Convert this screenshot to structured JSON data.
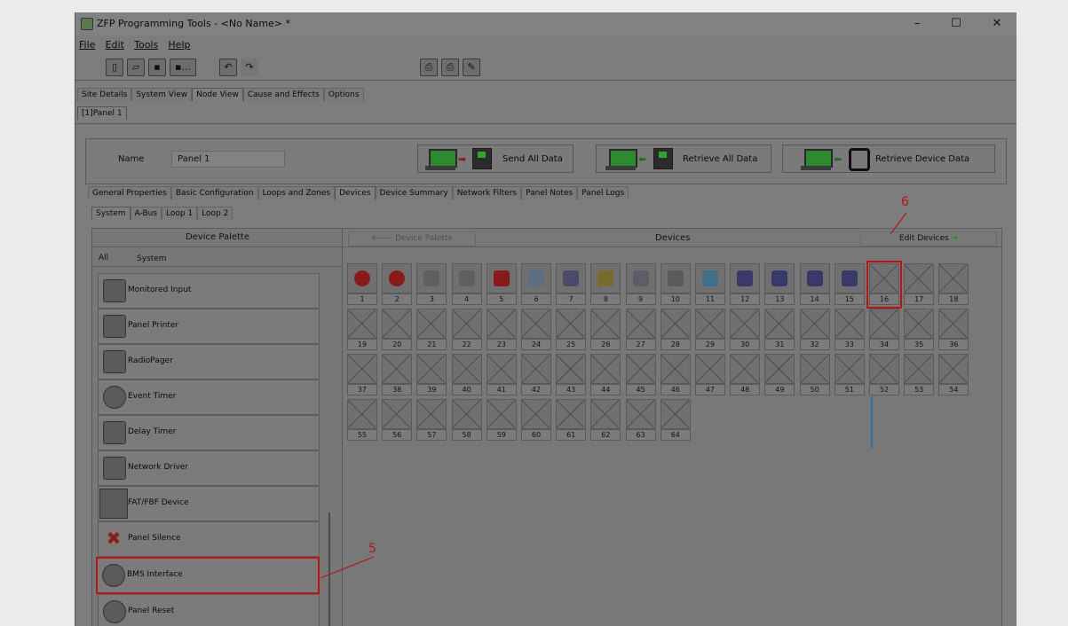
{
  "window": {
    "title": "ZFP Programming Tools - <No Name> *",
    "controls": [
      "–",
      "☐",
      "✕"
    ]
  },
  "menu": [
    "File",
    "Edit",
    "Tools",
    "Help"
  ],
  "toolbar": {
    "icons": [
      "new-icon",
      "open-icon",
      "save-icon",
      "save-as-icon",
      "undo-icon",
      "redo-icon",
      "print-icon",
      "print-preview-icon",
      "print-setup-icon"
    ],
    "save_as_suffix": "..."
  },
  "main_tabs": [
    "Site Details",
    "System View",
    "Node View",
    "Cause and Effects",
    "Options"
  ],
  "node_tab": "[1]Panel 1",
  "name_label": "Name",
  "name_value": "Panel 1",
  "buttons": {
    "send": "Send All Data",
    "retrieve": "Retrieve All Data",
    "retrieve_device": "Retrieve Device Data"
  },
  "sub_tabs": [
    "General Properties",
    "Basic Configuration",
    "Loops and Zones",
    "Devices",
    "Device Summary",
    "Network Filters",
    "Panel Notes",
    "Panel Logs"
  ],
  "bus_tabs": [
    "System",
    "A-Bus",
    "Loop 1",
    "Loop 2"
  ],
  "palette": {
    "title": "Device Palette",
    "filters": [
      "All",
      "System"
    ],
    "items": [
      "Monitored Input",
      "Panel Printer",
      "RadioPager",
      "Event Timer",
      "Delay Timer",
      "Network Driver",
      "FAT/FBF Device",
      "Panel Silence",
      "BMS Interface",
      "Panel Reset"
    ]
  },
  "devices": {
    "back_button": "Device Palette",
    "title": "Devices",
    "edit_button": "Edit Devices",
    "numbers": [
      "1",
      "2",
      "3",
      "4",
      "5",
      "6",
      "7",
      "8",
      "9",
      "10",
      "11",
      "12",
      "13",
      "14",
      "15",
      "16",
      "17",
      "18",
      "19",
      "20",
      "21",
      "22",
      "23",
      "24",
      "25",
      "26",
      "27",
      "28",
      "29",
      "30",
      "31",
      "32",
      "33",
      "34",
      "35",
      "36",
      "37",
      "38",
      "39",
      "40",
      "41",
      "42",
      "43",
      "44",
      "45",
      "46",
      "47",
      "48",
      "49",
      "50",
      "51",
      "52",
      "53",
      "54",
      "55",
      "56",
      "57",
      "58",
      "59",
      "60",
      "61",
      "62",
      "63",
      "64"
    ]
  },
  "callouts": {
    "five": "5",
    "six": "6"
  },
  "colors": {
    "highlight": "#b81515",
    "device_green": "#2fa52f"
  }
}
